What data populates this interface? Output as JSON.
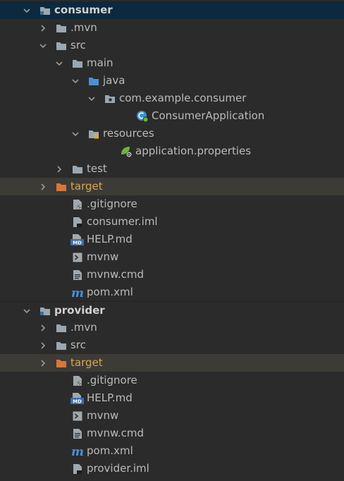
{
  "tree": [
    {
      "label": "consumer",
      "icon": "module-folder-icon",
      "arrow": "down",
      "level": 0,
      "bold": true,
      "selected": true
    },
    {
      "label": ".mvn",
      "icon": "folder-icon",
      "arrow": "right",
      "level": 1
    },
    {
      "label": "src",
      "icon": "folder-icon",
      "arrow": "down",
      "level": 1
    },
    {
      "label": "main",
      "icon": "folder-icon",
      "arrow": "down",
      "level": 2
    },
    {
      "label": "java",
      "icon": "source-folder-icon",
      "arrow": "down",
      "level": 3
    },
    {
      "label": "com.example.consumer",
      "icon": "package-icon",
      "arrow": "down",
      "level": 4
    },
    {
      "label": "ConsumerApplication",
      "icon": "spring-boot-class-icon",
      "arrow": "none",
      "level": 6
    },
    {
      "label": "resources",
      "icon": "resources-folder-icon",
      "arrow": "down",
      "level": 3
    },
    {
      "label": "application.properties",
      "icon": "spring-properties-icon",
      "arrow": "none",
      "level": 5
    },
    {
      "label": "test",
      "icon": "folder-icon",
      "arrow": "right",
      "level": 2
    },
    {
      "label": "target",
      "icon": "excluded-folder-icon",
      "arrow": "right",
      "level": 1,
      "excluded": true
    },
    {
      "label": ".gitignore",
      "icon": "gitignore-file-icon",
      "arrow": "none",
      "level": 2
    },
    {
      "label": "consumer.iml",
      "icon": "iml-file-icon",
      "arrow": "none",
      "level": 2
    },
    {
      "label": "HELP.md",
      "icon": "markdown-file-icon",
      "arrow": "none",
      "level": 2
    },
    {
      "label": "mvnw",
      "icon": "shell-script-icon",
      "arrow": "none",
      "level": 2
    },
    {
      "label": "mvnw.cmd",
      "icon": "text-file-icon",
      "arrow": "none",
      "level": 2
    },
    {
      "label": "pom.xml",
      "icon": "maven-pom-icon",
      "arrow": "none",
      "level": 2
    },
    {
      "label": "provider",
      "icon": "module-folder-icon",
      "arrow": "down",
      "level": 0,
      "bold": true,
      "dividerTop": true
    },
    {
      "label": ".mvn",
      "icon": "folder-icon",
      "arrow": "right",
      "level": 1
    },
    {
      "label": "src",
      "icon": "folder-icon",
      "arrow": "right",
      "level": 1
    },
    {
      "label": "target",
      "icon": "excluded-folder-icon",
      "arrow": "right",
      "level": 1,
      "excluded": true
    },
    {
      "label": ".gitignore",
      "icon": "gitignore-file-icon",
      "arrow": "none",
      "level": 2
    },
    {
      "label": "HELP.md",
      "icon": "markdown-file-icon",
      "arrow": "none",
      "level": 2
    },
    {
      "label": "mvnw",
      "icon": "shell-script-icon",
      "arrow": "none",
      "level": 2
    },
    {
      "label": "mvnw.cmd",
      "icon": "text-file-icon",
      "arrow": "none",
      "level": 2
    },
    {
      "label": "pom.xml",
      "icon": "maven-pom-icon",
      "arrow": "none",
      "level": 2
    },
    {
      "label": "provider.iml",
      "icon": "iml-file-icon",
      "arrow": "none",
      "level": 2
    }
  ],
  "colors": {
    "background": "#2b2b2b",
    "selection": "#0d293e",
    "excluded_row": "#3d3b35",
    "folder": "#9aa7b0",
    "source_folder": "#4b8fd5",
    "excluded_folder": "#d9763a",
    "spring": "#6db33f",
    "text": "#bbbbbb"
  }
}
